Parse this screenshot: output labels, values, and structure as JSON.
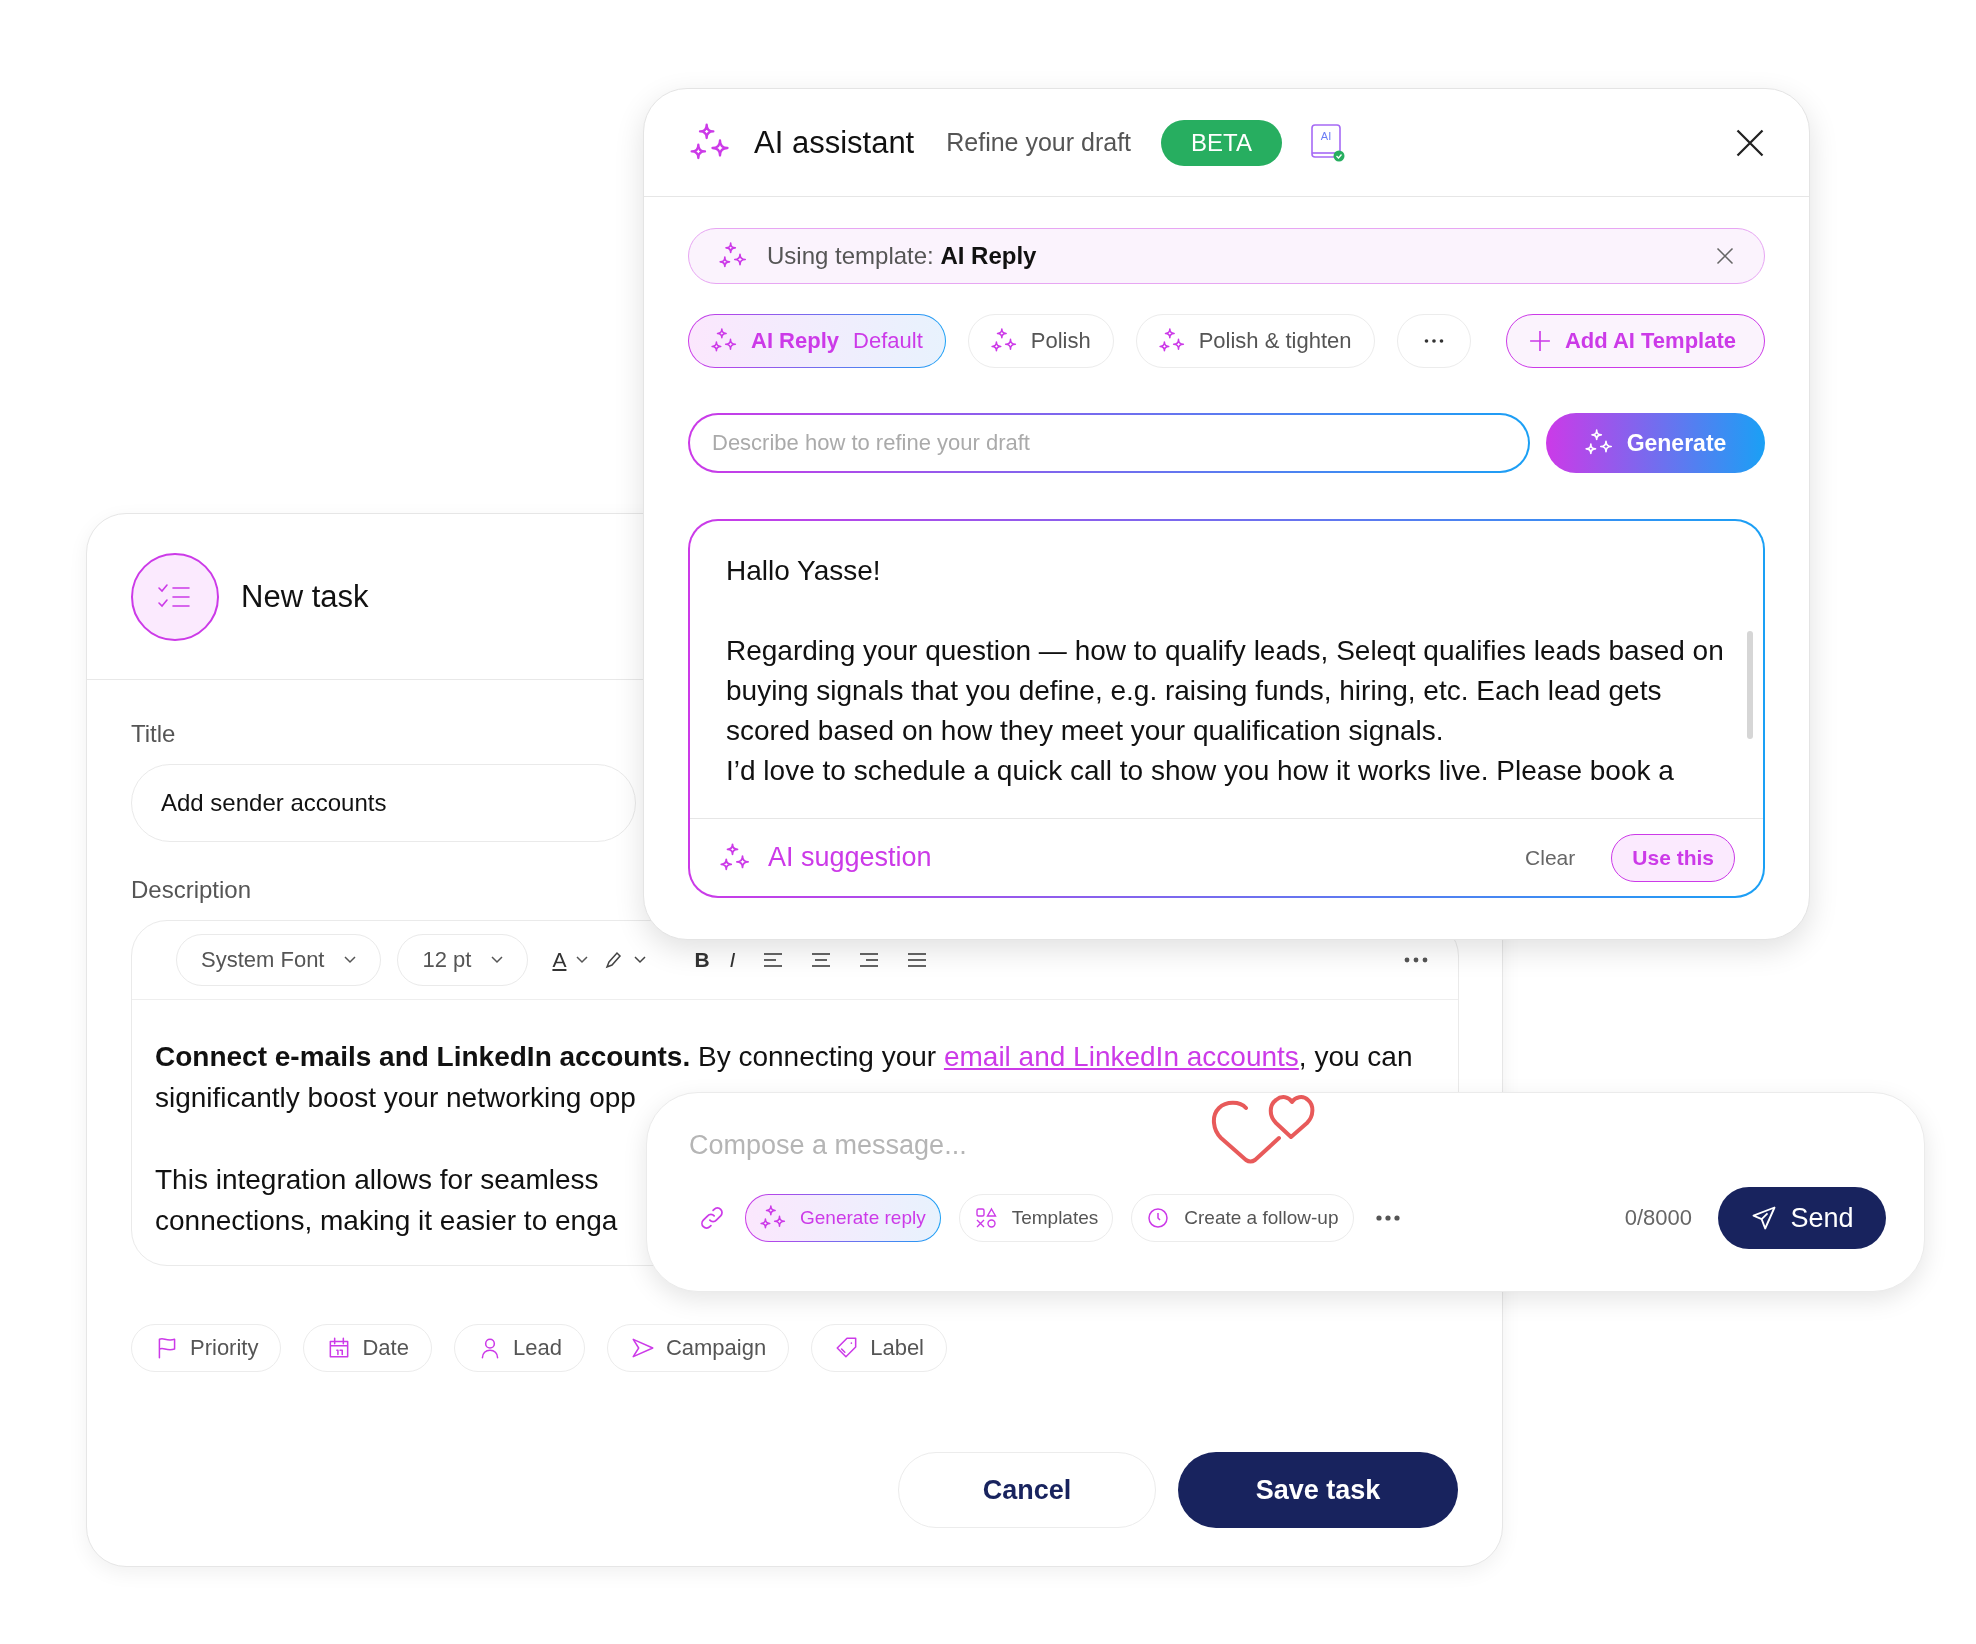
{
  "task": {
    "title": "New task",
    "title_field": {
      "label": "Title",
      "value": "Add sender accounts"
    },
    "description": {
      "label": "Description",
      "font": "System Font",
      "size": "12 pt",
      "color_letter": "A",
      "bold_letter": "B",
      "italic_letter": "I",
      "paragraphs": [
        [
          [
            {
              "kind": "bold",
              "text": "Connect e-mails and LinkedIn accounts."
            },
            {
              "kind": "plain",
              "text": " By connecting your "
            },
            {
              "kind": "link",
              "text": "email and LinkedIn accounts"
            },
            {
              "kind": "plain",
              "text": ", you can"
            }
          ],
          [
            {
              "kind": "plain",
              "text": "significantly boost your networking opp"
            }
          ]
        ],
        [
          [
            {
              "kind": "plain",
              "text": "This integration allows for seamless"
            }
          ],
          [
            {
              "kind": "plain",
              "text": "connections, making it easier to enga"
            }
          ]
        ]
      ]
    },
    "tags": [
      "Priority",
      "Date",
      "Lead",
      "Campaign",
      "Label"
    ],
    "cancel": "Cancel",
    "save": "Save task"
  },
  "ai": {
    "title": "AI assistant",
    "subtitle": "Refine your draft",
    "badge": "BETA",
    "book_label": "AI",
    "template": "Using template: **AI Reply**",
    "chips": [
      {
        "label": "AI Reply",
        "note": "Default",
        "selected": true
      },
      {
        "label": "Polish",
        "selected": false
      },
      {
        "label": "Polish & tighten",
        "selected": false
      }
    ],
    "add_template": "Add AI Template",
    "prompt_placeholder": "Describe how to refine your draft",
    "generate": "Generate",
    "suggestion": [
      "Hallo Yasse!",
      "Regarding your question — how to qualify leads, Seleqt qualifies leads based on buying signals that you define, e.g. raising funds, hiring, etc. Each lead gets scored based on how they meet your qualification signals.",
      "I’d love to schedule a quick call to show you how it works live. Please book a"
    ],
    "suggestion_label": "AI suggestion",
    "clear": "Clear",
    "use": "Use this"
  },
  "compose": {
    "placeholder": "Compose a message...",
    "actions": [
      {
        "label": "Generate reply",
        "selected": true
      },
      {
        "label": "Templates",
        "selected": false
      },
      {
        "label": "Create a follow-up",
        "selected": false
      }
    ],
    "counter": "0/8000",
    "send": "Send"
  }
}
